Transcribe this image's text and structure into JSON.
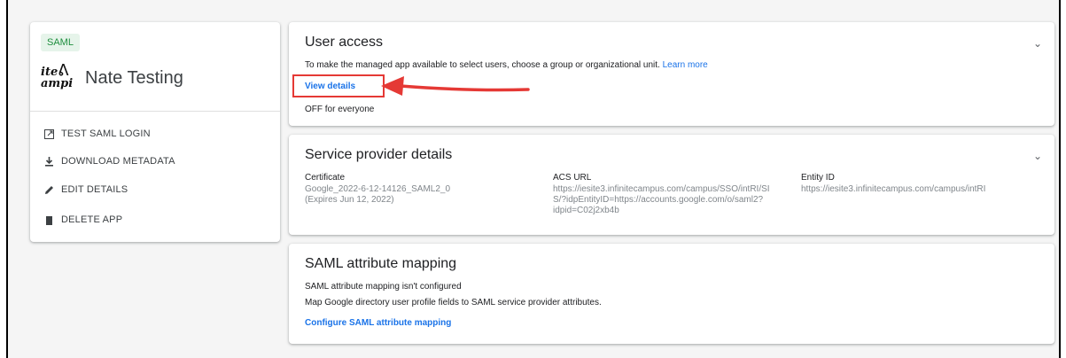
{
  "app": {
    "badge": "SAML",
    "logo_line1": "ite",
    "logo_line2": "ampi",
    "name": "Nate Testing",
    "actions": [
      {
        "label": "TEST SAML LOGIN",
        "icon": "external-link-icon"
      },
      {
        "label": "DOWNLOAD METADATA",
        "icon": "download-icon"
      },
      {
        "label": "EDIT DETAILS",
        "icon": "pencil-icon"
      },
      {
        "label": "DELETE APP",
        "icon": "trash-icon"
      }
    ]
  },
  "user_access": {
    "title": "User access",
    "description": "To make the managed app available to select users, choose a group or organizational unit.",
    "learn_more": "Learn more",
    "view_details": "View details",
    "status": "OFF for everyone"
  },
  "service_provider": {
    "title": "Service provider details",
    "certificate_label": "Certificate",
    "certificate_value": "Google_2022-6-12-14126_SAML2_0",
    "certificate_expiry": "(Expires Jun 12, 2022)",
    "acs_label": "ACS URL",
    "acs_lines": [
      "https://iesite3.infinitecampus.com/campus/SSO/intRI/SI",
      "S/?idpEntityID=https://accounts.google.com/o/saml2?",
      "idpid=C02j2xb4b"
    ],
    "entity_label": "Entity ID",
    "entity_value": "https://iesite3.infinitecampus.com/campus/intRI"
  },
  "attribute_mapping": {
    "title": "SAML attribute mapping",
    "status": "SAML attribute mapping isn't configured",
    "description": "Map Google directory user profile fields to SAML service provider attributes.",
    "configure_link": "Configure SAML attribute mapping"
  },
  "colors": {
    "accent": "#1a73e8",
    "annotation": "#e53935",
    "badge_bg": "#e6f4ea",
    "badge_text": "#1e8e3e"
  }
}
